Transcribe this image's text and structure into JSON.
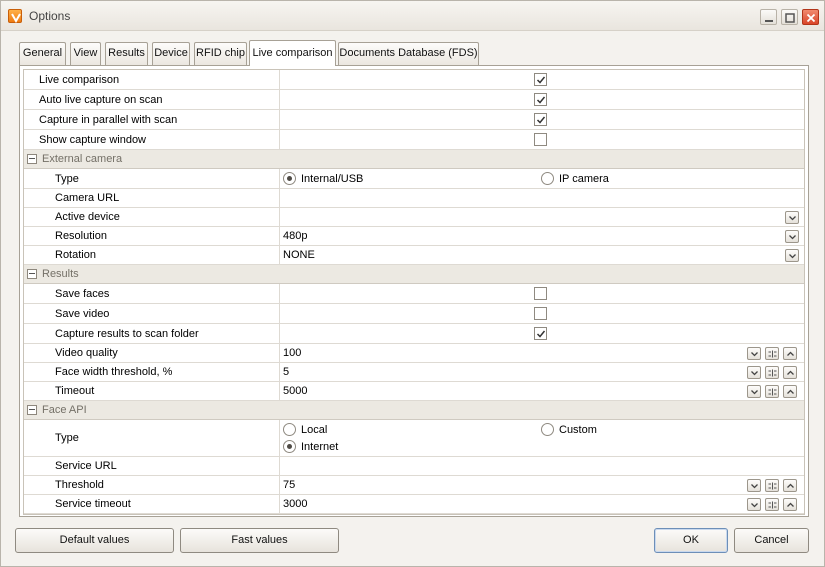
{
  "window": {
    "title": "Options"
  },
  "tabs": [
    {
      "label": "General"
    },
    {
      "label": "View"
    },
    {
      "label": "Results"
    },
    {
      "label": "Device"
    },
    {
      "label": "RFID chip"
    },
    {
      "label": "Live comparison",
      "active": true
    },
    {
      "label": "Documents Database (FDS)"
    }
  ],
  "top_rows": [
    {
      "label": "Live comparison",
      "checked": true
    },
    {
      "label": "Auto live capture on scan",
      "checked": true
    },
    {
      "label": "Capture in parallel with scan",
      "checked": true
    },
    {
      "label": "Show capture window",
      "checked": false
    }
  ],
  "external_camera": {
    "title": "External camera",
    "type_label": "Type",
    "type_options": [
      {
        "label": "Internal/USB",
        "selected": true
      },
      {
        "label": "IP camera",
        "selected": false
      }
    ],
    "camera_url_label": "Camera URL",
    "camera_url_value": "",
    "active_device_label": "Active device",
    "active_device_value": "",
    "resolution_label": "Resolution",
    "resolution_value": "480p",
    "rotation_label": "Rotation",
    "rotation_value": "NONE"
  },
  "results": {
    "title": "Results",
    "save_faces_label": "Save faces",
    "save_faces_checked": false,
    "save_video_label": "Save video",
    "save_video_checked": false,
    "capture_to_folder_label": "Capture results to scan folder",
    "capture_to_folder_checked": true,
    "video_quality_label": "Video quality",
    "video_quality_value": "100",
    "face_width_label": "Face width threshold, %",
    "face_width_value": "5",
    "timeout_label": "Timeout",
    "timeout_value": "5000"
  },
  "face_api": {
    "title": "Face API",
    "type_label": "Type",
    "type_options": [
      {
        "label": "Local",
        "selected": false
      },
      {
        "label": "Custom",
        "selected": false
      },
      {
        "label": "Internet",
        "selected": true
      }
    ],
    "service_url_label": "Service URL",
    "service_url_value": "",
    "threshold_label": "Threshold",
    "threshold_value": "75",
    "service_timeout_label": "Service timeout",
    "service_timeout_value": "3000"
  },
  "footer": {
    "default_values": "Default values",
    "fast_values": "Fast values",
    "ok": "OK",
    "cancel": "Cancel"
  },
  "icons": {
    "app": "app-logo-icon",
    "minimize": "minimize-icon",
    "maximize": "maximize-icon",
    "close": "close-icon",
    "check": "checkmark-icon",
    "dropdown": "chevron-down-icon",
    "spin_up": "chevron-up-icon",
    "reset": "reset-icon",
    "collapse": "collapse-icon"
  },
  "colors": {
    "window_bg": "#f4f2ee",
    "group_header_bg": "#ece9e2",
    "close_button": "#d9462a",
    "app_icon": "#ef7b12"
  }
}
